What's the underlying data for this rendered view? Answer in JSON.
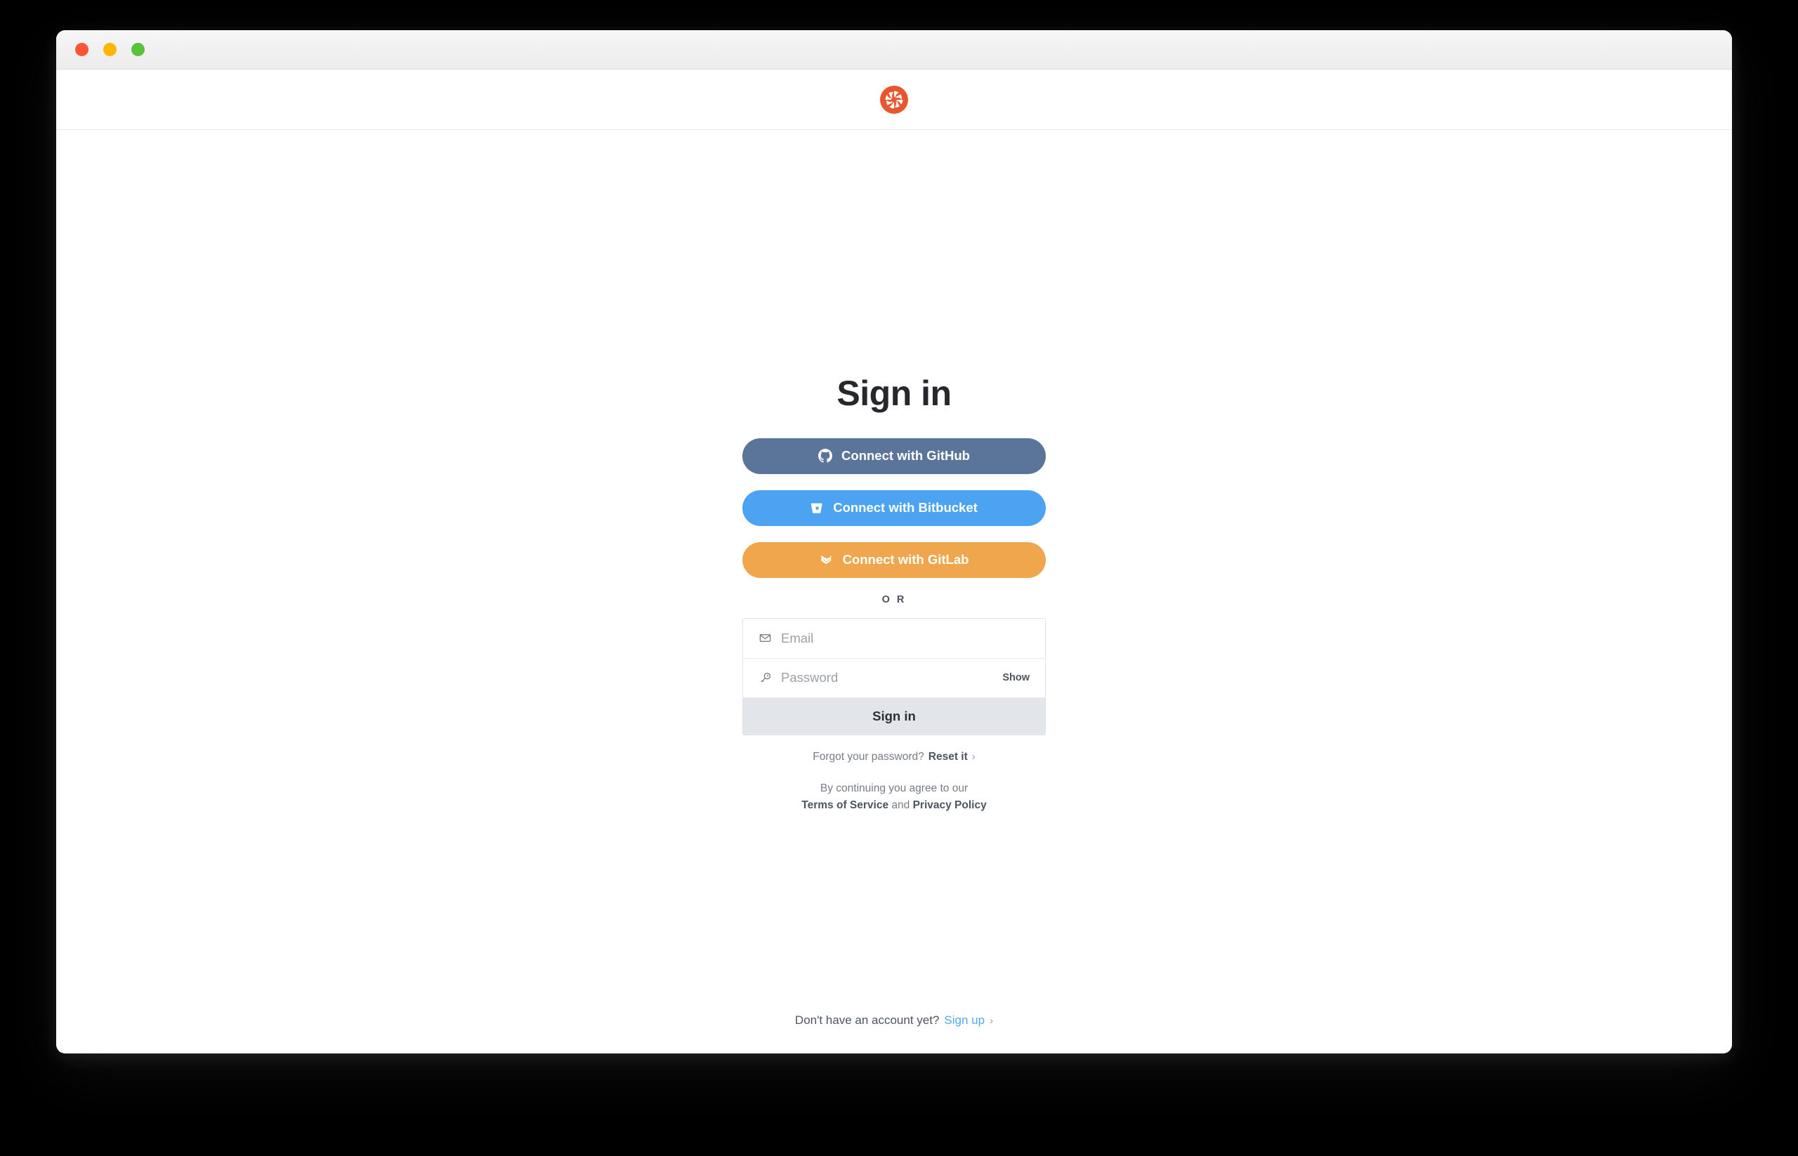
{
  "window": {
    "traffic_lights": [
      {
        "name": "close",
        "color": "#ff5436"
      },
      {
        "name": "minimize",
        "color": "#ffb600"
      },
      {
        "name": "zoom",
        "color": "#58c23c"
      }
    ]
  },
  "header": {
    "logo_name": "codacy-logo",
    "logo_color": "#e8562f"
  },
  "main": {
    "title": "Sign in",
    "providers": [
      {
        "id": "github",
        "label": "Connect with GitHub",
        "icon": "github-icon",
        "color": "#5b7499"
      },
      {
        "id": "bitbucket",
        "label": "Connect with Bitbucket",
        "icon": "bitbucket-icon",
        "color": "#4ba3f2"
      },
      {
        "id": "gitlab",
        "label": "Connect with GitLab",
        "icon": "gitlab-icon",
        "color": "#efa64c"
      }
    ],
    "divider_label": "O R",
    "form": {
      "email": {
        "icon": "envelope-icon",
        "placeholder": "Email",
        "value": ""
      },
      "password": {
        "icon": "key-icon",
        "placeholder": "Password",
        "value": "",
        "show_label": "Show"
      },
      "submit_label": "Sign in"
    },
    "forgot": {
      "text": "Forgot your password?",
      "link": "Reset it",
      "chevron": "›"
    },
    "legal": {
      "line1": "By continuing you agree to our",
      "terms": "Terms of Service",
      "and": "and",
      "privacy": "Privacy Policy"
    }
  },
  "footer": {
    "text": "Don't have an account yet?",
    "link": "Sign up",
    "chevron": "›",
    "link_color": "#53a8ef"
  }
}
